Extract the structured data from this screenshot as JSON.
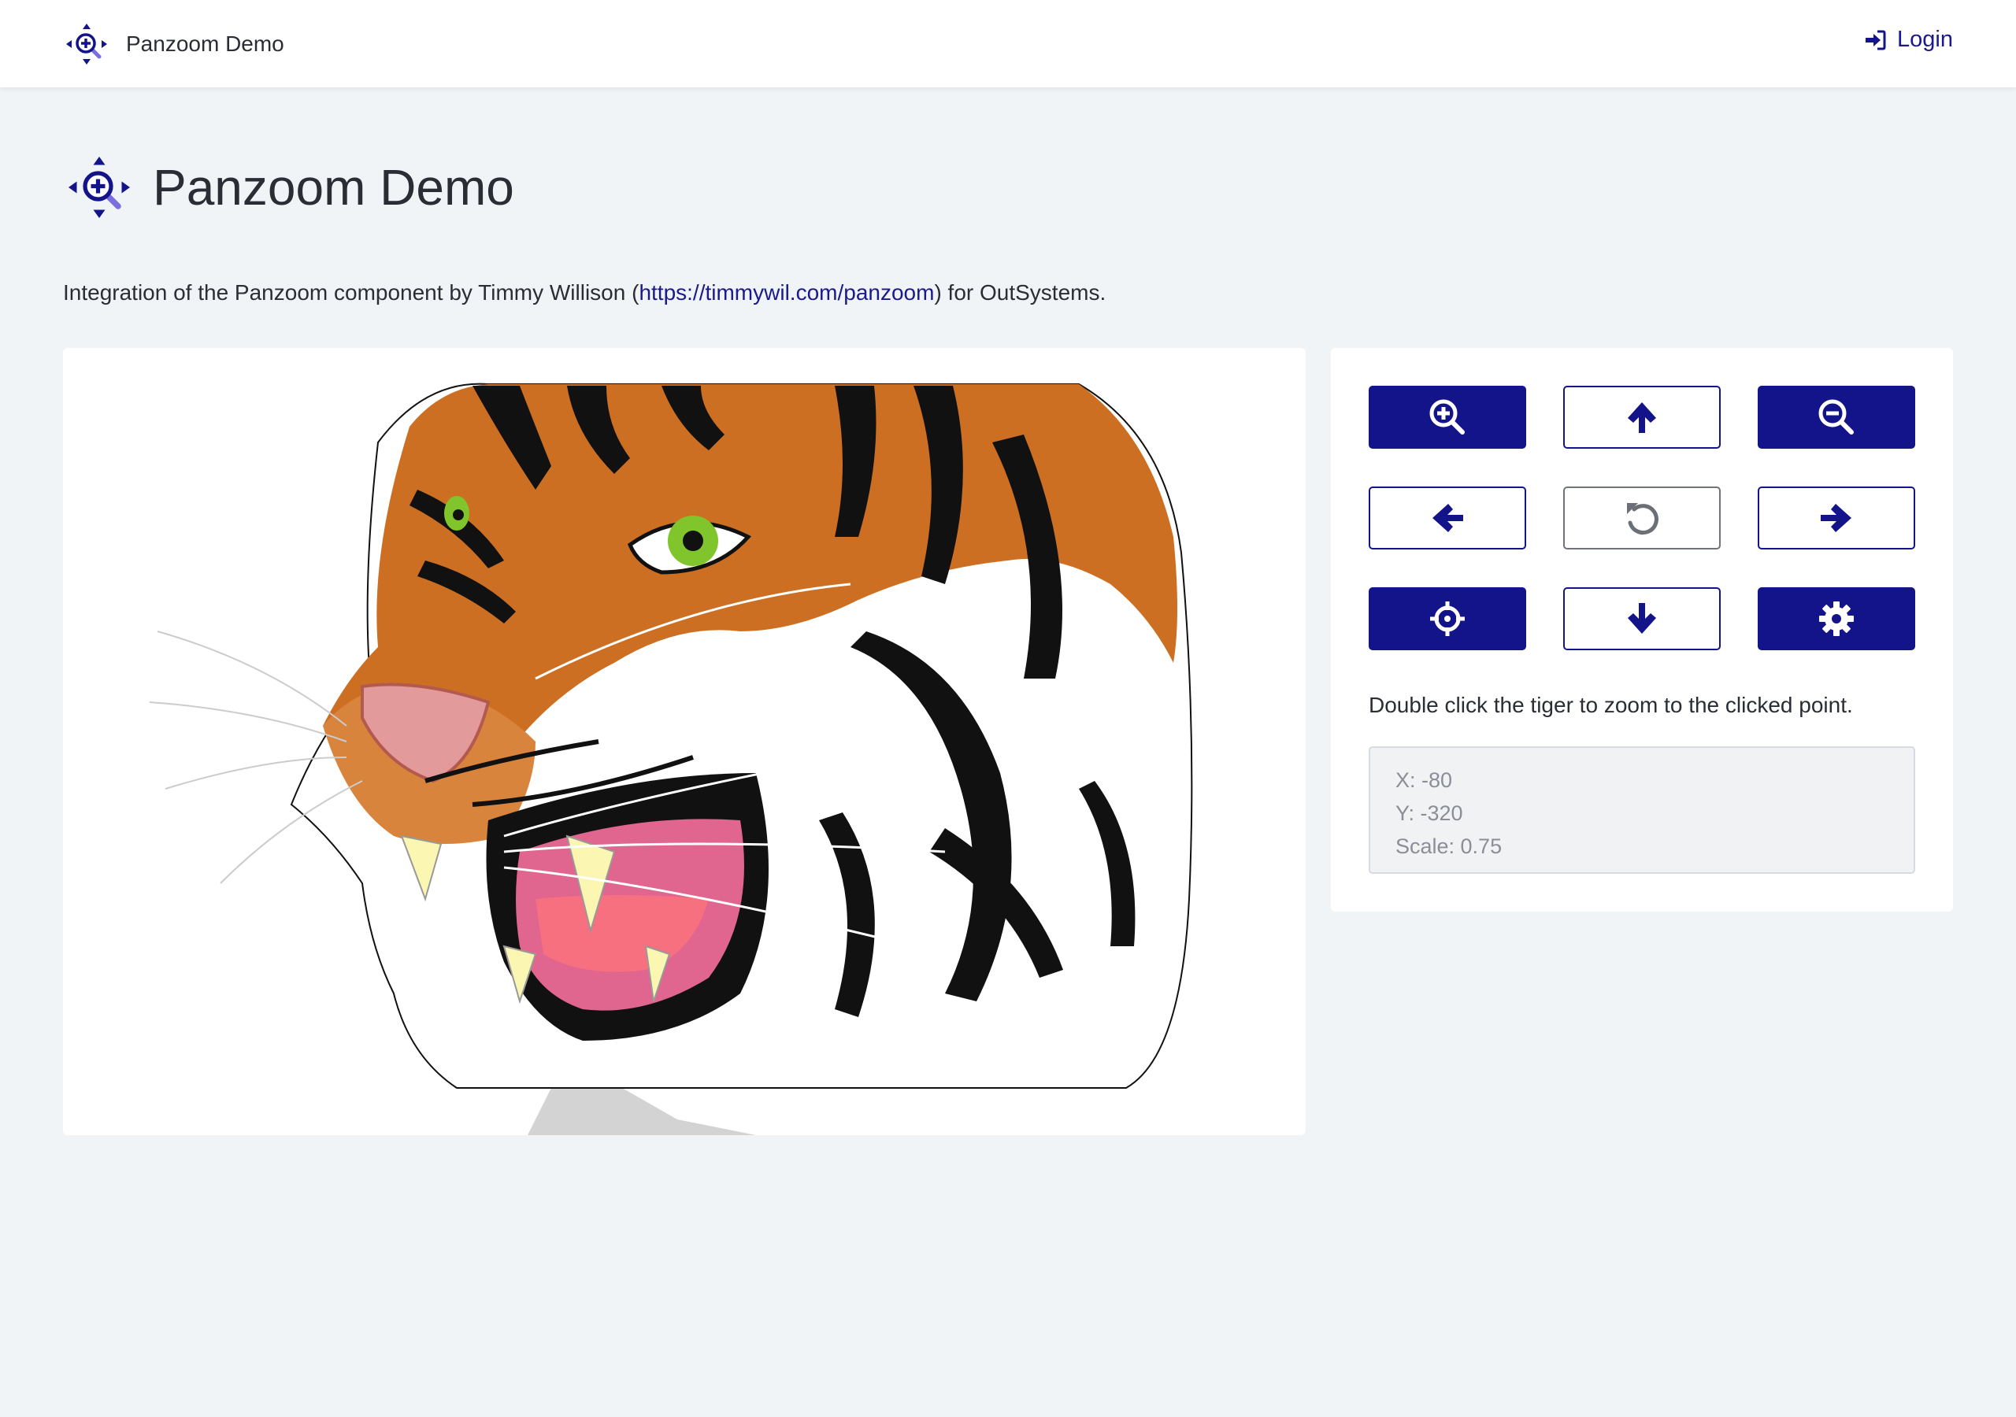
{
  "header": {
    "brand": "Panzoom Demo",
    "login_label": "Login"
  },
  "page": {
    "title": "Panzoom Demo",
    "intro_before": "Integration of the Panzoom component by Timmy Willison (",
    "intro_link": "https://timmywil.com/panzoom",
    "intro_after": ") for OutSystems."
  },
  "controls": {
    "buttons": [
      {
        "name": "zoom-in",
        "icon": "magnifier-plus-icon",
        "style": "solid"
      },
      {
        "name": "pan-up",
        "icon": "arrow-up-icon",
        "style": "outline"
      },
      {
        "name": "zoom-out",
        "icon": "magnifier-minus-icon",
        "style": "solid"
      },
      {
        "name": "pan-left",
        "icon": "arrow-left-icon",
        "style": "outline"
      },
      {
        "name": "reset",
        "icon": "reset-icon",
        "style": "neutral"
      },
      {
        "name": "pan-right",
        "icon": "arrow-right-icon",
        "style": "outline"
      },
      {
        "name": "center",
        "icon": "crosshairs-icon",
        "style": "solid"
      },
      {
        "name": "pan-down",
        "icon": "arrow-down-icon",
        "style": "outline"
      },
      {
        "name": "settings",
        "icon": "gear-icon",
        "style": "solid"
      }
    ],
    "hint": "Double click the tiger to zoom to the clicked point.",
    "x_line": "X: -80",
    "y_line": "Y: -320",
    "scale_line": "Scale: 0.75"
  },
  "colors": {
    "primary": "#14148a",
    "background": "#f1f4f7",
    "card": "#ffffff"
  }
}
